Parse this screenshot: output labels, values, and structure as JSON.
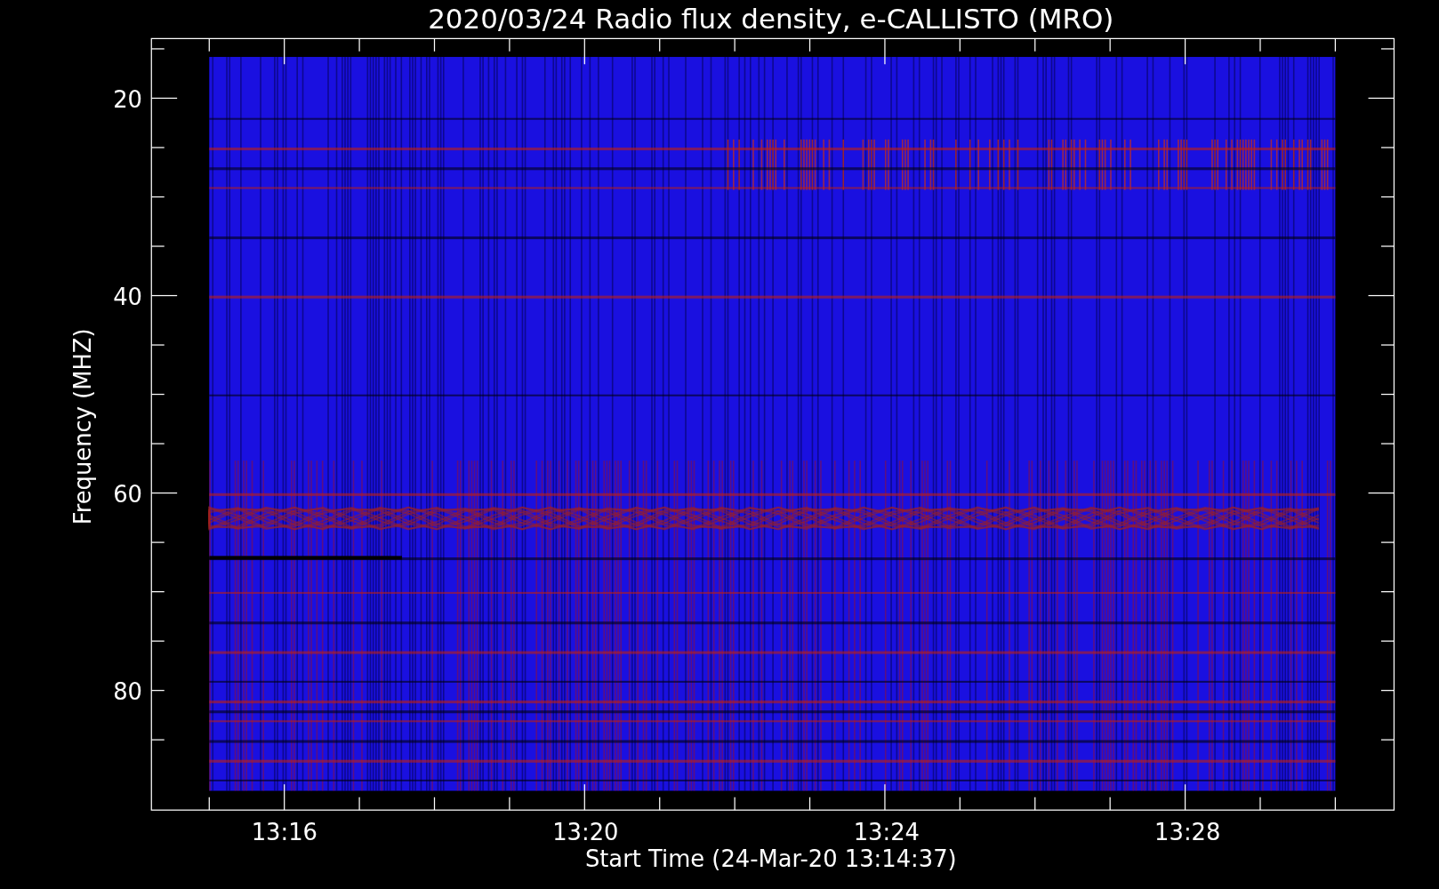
{
  "title": "2020/03/24  Radio flux density, e-CALLISTO (MRO)",
  "plot": {
    "xlabel": "Start Time (24-Mar-20 13:14:37)",
    "ylabel": "Frequency (MHZ)",
    "xticks": [
      {
        "label": "13:16"
      },
      {
        "label": "13:20"
      },
      {
        "label": "13:24"
      },
      {
        "label": "13:28"
      }
    ],
    "yticks": [
      {
        "label": "20"
      },
      {
        "label": "40"
      },
      {
        "label": "60"
      },
      {
        "label": "80"
      }
    ]
  }
}
